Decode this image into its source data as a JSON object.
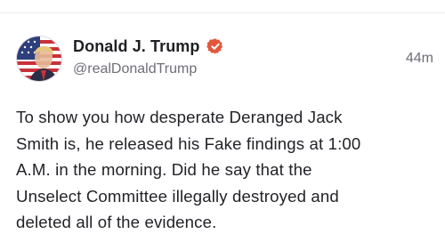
{
  "author": {
    "display_name": "Donald J. Trump",
    "handle": "@realDonaldTrump",
    "verified": true,
    "verified_icon": "verified-badge-icon",
    "avatar": "avatar-flag-portrait"
  },
  "post": {
    "timestamp": "44m",
    "lines": [
      "To show you how desperate Deranged Jack",
      "Smith is, he released his Fake findings at 1:00",
      "A.M. in the morning. Did he say that the",
      "Unselect Committee illegally destroyed and",
      "deleted all of the evidence."
    ]
  },
  "colors": {
    "verified": "#E3573D",
    "text": "#222228",
    "muted": "#6E6E78"
  }
}
